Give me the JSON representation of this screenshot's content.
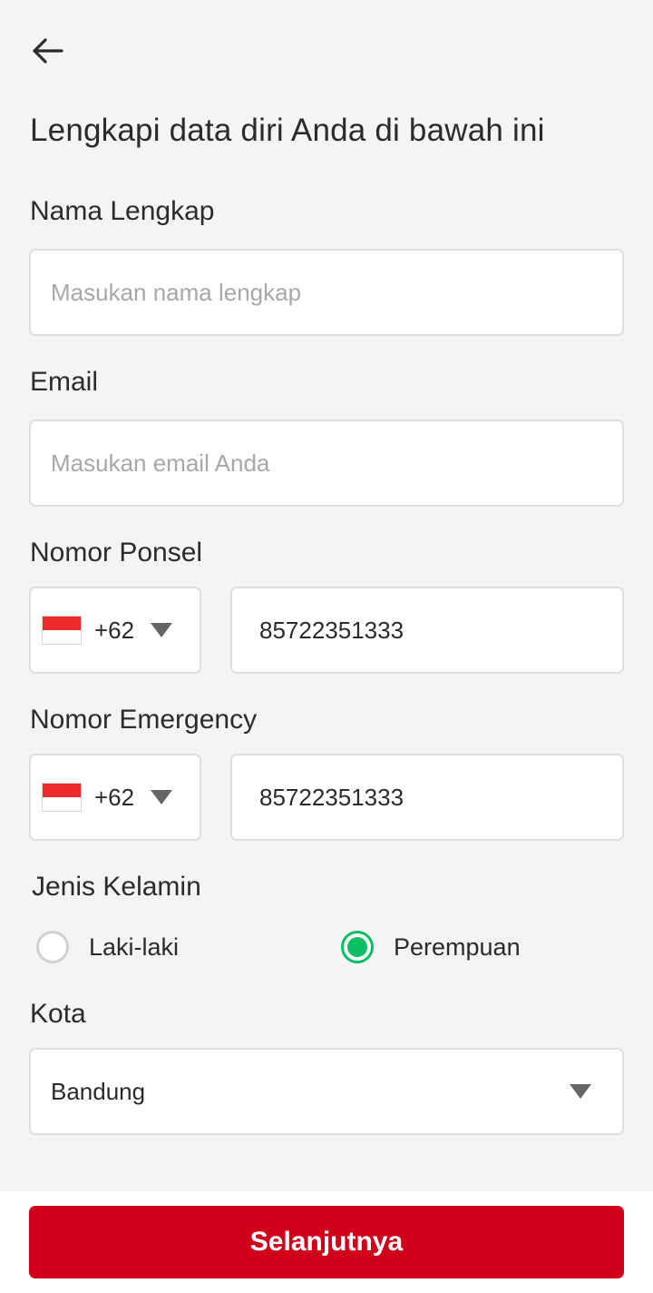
{
  "header": {
    "back_icon": "arrow-left-icon",
    "title": "Lengkapi data diri Anda di bawah ini"
  },
  "form": {
    "name": {
      "label": "Nama Lengkap",
      "placeholder": "Masukan nama lengkap",
      "value": ""
    },
    "email": {
      "label": "Email",
      "placeholder": "Masukan email Anda",
      "value": ""
    },
    "phone": {
      "label": "Nomor Ponsel",
      "country_code": "+62",
      "flag": "indonesia-flag-icon",
      "value": "85722351333"
    },
    "emergency": {
      "label": "Nomor Emergency",
      "country_code": "+62",
      "flag": "indonesia-flag-icon",
      "value": "85722351333"
    },
    "gender": {
      "label": "Jenis Kelamin",
      "options": [
        {
          "label": "Laki-laki",
          "selected": false
        },
        {
          "label": "Perempuan",
          "selected": true
        }
      ]
    },
    "city": {
      "label": "Kota",
      "value": "Bandung"
    }
  },
  "footer": {
    "next_label": "Selanjutnya"
  },
  "colors": {
    "primary": "#d0011b",
    "radio_selected": "#0bbd63",
    "background": "#f4f4f4"
  }
}
